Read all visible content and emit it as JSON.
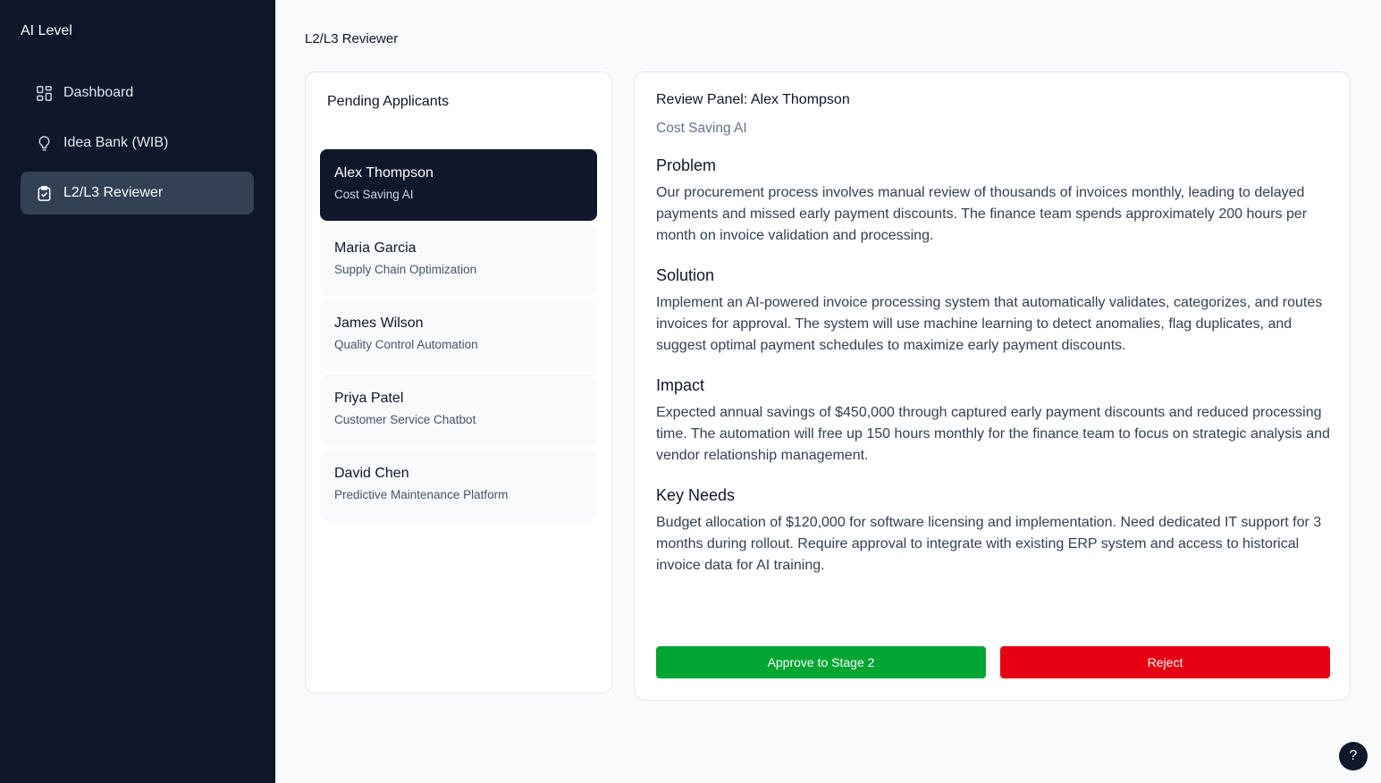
{
  "app": {
    "title": "AI Level"
  },
  "sidebar": {
    "items": [
      {
        "label": "Dashboard",
        "icon": "dashboard-icon",
        "active": false
      },
      {
        "label": "Idea Bank (WIB)",
        "icon": "lightbulb-icon",
        "active": false
      },
      {
        "label": "L2/L3 Reviewer",
        "icon": "clipboard-check-icon",
        "active": true
      }
    ]
  },
  "page": {
    "title": "L2/L3 Reviewer"
  },
  "pending": {
    "title": "Pending Applicants",
    "applicants": [
      {
        "name": "Alex Thompson",
        "project": "Cost Saving AI",
        "selected": true
      },
      {
        "name": "Maria Garcia",
        "project": "Supply Chain Optimization",
        "selected": false
      },
      {
        "name": "James Wilson",
        "project": "Quality Control Automation",
        "selected": false
      },
      {
        "name": "Priya Patel",
        "project": "Customer Service Chatbot",
        "selected": false
      },
      {
        "name": "David Chen",
        "project": "Predictive Maintenance Platform",
        "selected": false
      }
    ]
  },
  "review": {
    "title": "Review Panel: Alex Thompson",
    "subtitle": "Cost Saving AI",
    "sections": [
      {
        "heading": "Problem",
        "text": "Our procurement process involves manual review of thousands of invoices monthly, leading to delayed payments and missed early payment discounts. The finance team spends approximately 200 hours per month on invoice validation and processing."
      },
      {
        "heading": "Solution",
        "text": "Implement an AI-powered invoice processing system that automatically validates, categorizes, and routes invoices for approval. The system will use machine learning to detect anomalies, flag duplicates, and suggest optimal payment schedules to maximize early payment discounts."
      },
      {
        "heading": "Impact",
        "text": "Expected annual savings of $450,000 through captured early payment discounts and reduced processing time. The automation will free up 150 hours monthly for the finance team to focus on strategic analysis and vendor relationship management."
      },
      {
        "heading": "Key Needs",
        "text": "Budget allocation of $120,000 for software licensing and implementation. Need dedicated IT support for 3 months during rollout. Require approval to integrate with existing ERP system and access to historical invoice data for AI training."
      }
    ],
    "approve_label": "Approve to Stage 2",
    "reject_label": "Reject"
  },
  "help": {
    "label": "?"
  },
  "colors": {
    "sidebar_bg": "#0f172a",
    "approve": "#00a532",
    "reject": "#e60012",
    "active_nav": "#334155"
  }
}
